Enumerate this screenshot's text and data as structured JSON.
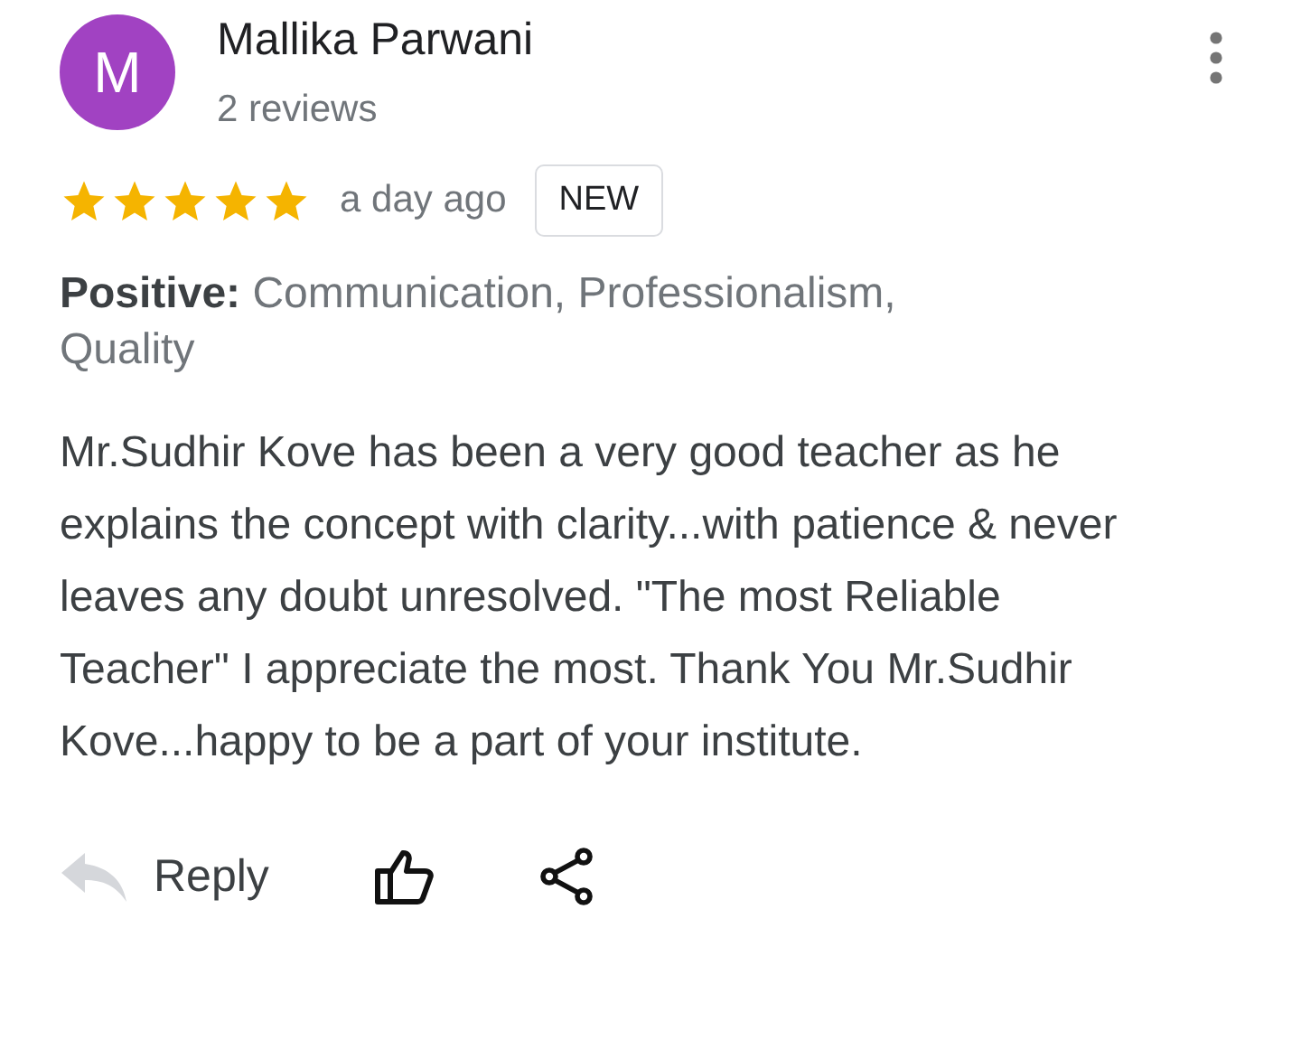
{
  "review": {
    "avatar_letter": "M",
    "author": "Mallika Parwani",
    "review_count": "2 reviews",
    "stars": 5,
    "time": "a day ago",
    "badge": "NEW",
    "highlights": "**Positive:** Communication, Professionalism, Quality",
    "text": "Mr.Sudhir Kove has been a very good teacher as he explains the concept with clarity...with patience & never leaves any doubt unresolved. \"The most Reliable Teacher\" I appreciate the most. Thank You Mr.Sudhir Kove...happy to be a part of your institute."
  },
  "actions": {
    "reply": "Reply"
  }
}
